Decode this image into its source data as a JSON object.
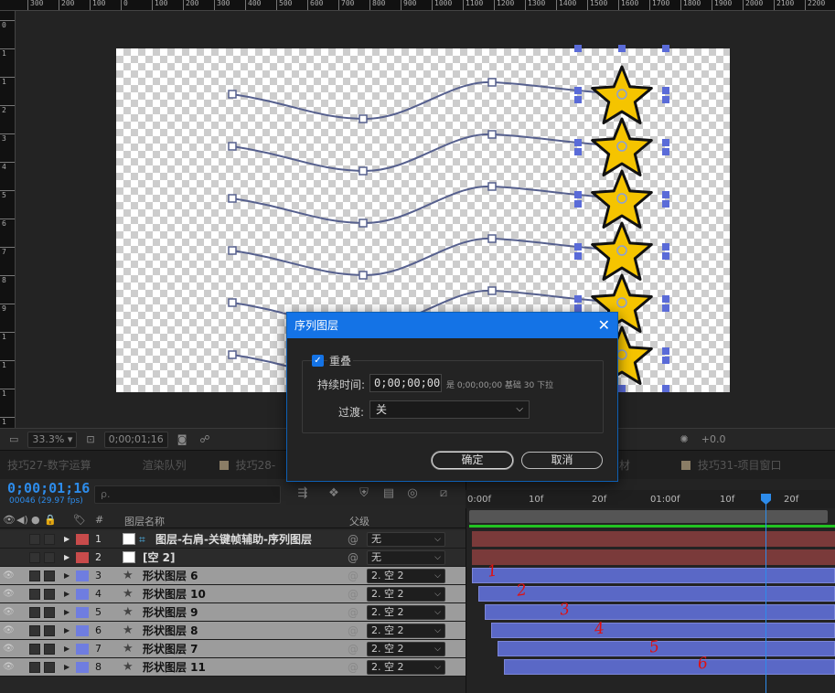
{
  "ruler_top": [
    "300",
    "200",
    "100",
    "0",
    "100",
    "200",
    "300",
    "400",
    "500",
    "600",
    "700",
    "800",
    "900",
    "1000",
    "1100",
    "1200",
    "1300",
    "1400",
    "1500",
    "1600",
    "1700",
    "1800",
    "1900",
    "2000",
    "2100",
    "2200",
    "230"
  ],
  "ruler_left": [
    "0",
    "1",
    "1",
    "2",
    "3",
    "4",
    "5",
    "6",
    "7",
    "8",
    "9",
    "1",
    "1",
    "1",
    "1"
  ],
  "viewer_bar": {
    "zoom": "33.3%",
    "timecode": "0;00;01;16",
    "exposure": "+0.0"
  },
  "tabs": [
    "技巧27-数字运算",
    "渲染队列",
    "技巧28-",
    "30-替换素材",
    "技巧31-项目窗口"
  ],
  "timeline": {
    "timecode": "0;00;01;16",
    "fps": "00046 (29.97 fps)",
    "search_placeholder": "ρ.",
    "columns": {
      "num": "#",
      "name": "图层名称",
      "parent": "父级"
    },
    "time_labels": [
      "0:00f",
      "10f",
      "20f",
      "01:00f",
      "10f",
      "20f"
    ],
    "layers": [
      {
        "num": "1",
        "name": "图层-右肩-关键帧辅助-序列图层",
        "parent": "无",
        "label": "#c84b4b",
        "type": "comp"
      },
      {
        "num": "2",
        "name": "[空 2]",
        "parent": "无",
        "label": "#c84b4b",
        "type": "null"
      },
      {
        "num": "3",
        "name": "形状图层 6",
        "parent": "2. 空 2",
        "label": "#6f7de0",
        "type": "shape"
      },
      {
        "num": "4",
        "name": "形状图层 10",
        "parent": "2. 空 2",
        "label": "#6f7de0",
        "type": "shape"
      },
      {
        "num": "5",
        "name": "形状图层 9",
        "parent": "2. 空 2",
        "label": "#6f7de0",
        "type": "shape"
      },
      {
        "num": "6",
        "name": "形状图层 8",
        "parent": "2. 空 2",
        "label": "#6f7de0",
        "type": "shape"
      },
      {
        "num": "7",
        "name": "形状图层 7",
        "parent": "2. 空 2",
        "label": "#6f7de0",
        "type": "shape"
      },
      {
        "num": "8",
        "name": "形状图层 11",
        "parent": "2. 空 2",
        "label": "#6f7de0",
        "type": "shape"
      }
    ],
    "annotations": [
      "1",
      "2",
      "3",
      "4",
      "5",
      "6"
    ]
  },
  "dialog": {
    "title": "序列图层",
    "overlap_label": "重叠",
    "overlap_checked": true,
    "duration_label": "持续时间:",
    "duration_value": "0;00;00;00",
    "duration_info": "是 0;00;00;00  基础 30  下拉",
    "transition_label": "过渡:",
    "transition_value": "关",
    "ok_label": "确定",
    "cancel_label": "取消"
  },
  "colors": {
    "accent": "#1473e6",
    "timecode": "#2d8ceb",
    "star_fill": "#f5c400",
    "bar_shape": "#5a68c6",
    "bar_red": "#7a3a3a"
  }
}
